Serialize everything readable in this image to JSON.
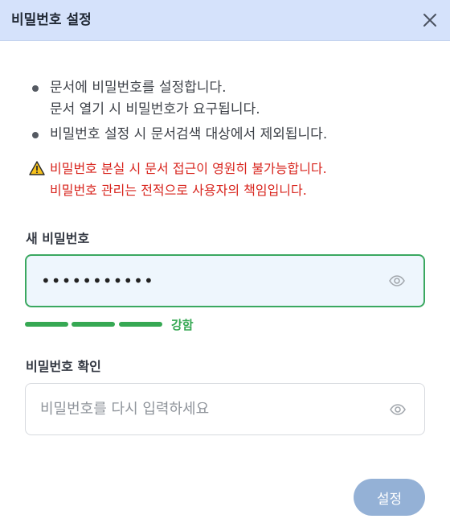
{
  "dialog": {
    "title": "비밀번호 설정",
    "close_icon": "close-icon"
  },
  "info": {
    "items": [
      {
        "lines": [
          "문서에 비밀번호를 설정합니다.",
          "문서 열기 시 비밀번호가 요구됩니다."
        ]
      },
      {
        "lines": [
          "비밀번호 설정 시 문서검색 대상에서 제외됩니다."
        ]
      }
    ]
  },
  "warning": {
    "icon": "warning-triangle-icon",
    "lines": [
      "비밀번호 분실 시 문서 접근이 영원히 불가능합니다.",
      "비밀번호 관리는 전적으로 사용자의 책임입니다."
    ],
    "color": "#d8241d"
  },
  "new_password": {
    "label": "새 비밀번호",
    "value": "•••••••••••",
    "icon": "eye-icon"
  },
  "strength": {
    "label": "강함",
    "level": 3,
    "max": 3,
    "color": "#36a853"
  },
  "confirm_password": {
    "label": "비밀번호 확인",
    "value": "",
    "placeholder": "비밀번호를 다시 입력하세요",
    "icon": "eye-icon"
  },
  "actions": {
    "submit_label": "설정"
  },
  "colors": {
    "header_bg": "#d5e2fb",
    "focus_border": "#3aa860",
    "button_bg": "#94b1d6"
  }
}
